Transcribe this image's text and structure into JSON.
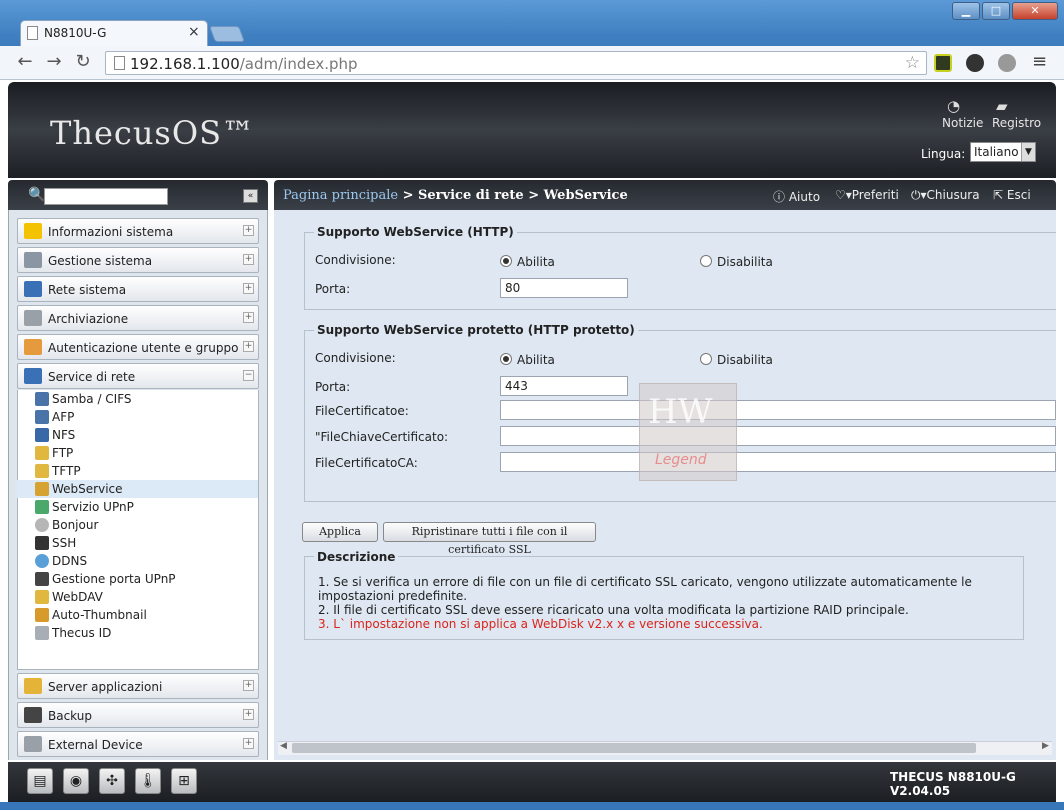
{
  "browser": {
    "tab_title": "N8810U-G",
    "tab_close": "×",
    "url_host": "192.168.1.100",
    "url_path": "/adm/index.php",
    "back": "←",
    "forward": "→",
    "reload": "↻",
    "star": "☆",
    "menu": "≡",
    "win_minimize": "▁",
    "win_maximize": "□",
    "win_close": "✕"
  },
  "header": {
    "logo": "ThecusOS™",
    "notizie": "Notizie",
    "registro": "Registro",
    "lingua_label": "Lingua:",
    "lingua_value": "Italiano"
  },
  "sidebar": {
    "collapse": "«",
    "groups_top": [
      {
        "label": "Informazioni sistema",
        "toggle": "+"
      },
      {
        "label": "Gestione sistema",
        "toggle": "+"
      },
      {
        "label": "Rete sistema",
        "toggle": "+"
      },
      {
        "label": "Archiviazione",
        "toggle": "+"
      },
      {
        "label": "Autenticazione utente e gruppo",
        "toggle": "+"
      },
      {
        "label": "Service di rete",
        "toggle": "−"
      }
    ],
    "subitems": [
      "Samba / CIFS",
      "AFP",
      "NFS",
      "FTP",
      "TFTP",
      "WebService",
      "Servizio UPnP",
      "Bonjour",
      "SSH",
      "DDNS",
      "Gestione porta UPnP",
      "WebDAV",
      "Auto-Thumbnail",
      "Thecus ID"
    ],
    "groups_bottom": [
      {
        "label": "Server applicazioni",
        "toggle": "+"
      },
      {
        "label": "Backup",
        "toggle": "+"
      },
      {
        "label": "External Device",
        "toggle": "+"
      }
    ]
  },
  "breadcrumb": {
    "home": "Pagina principale",
    "rest": " > Service di rete > WebService"
  },
  "actions": {
    "aiuto": "Aiuto",
    "preferiti": "Preferiti",
    "chiusura": "Chiusura",
    "esci": "Esci"
  },
  "http": {
    "legend": "Supporto WebService (HTTP)",
    "condivisione_label": "Condivisione:",
    "abilita": "Abilita",
    "disabilita": "Disabilita",
    "porta_label": "Porta:",
    "porta_value": "80"
  },
  "https": {
    "legend": "Supporto WebService protetto (HTTP protetto)",
    "condivisione_label": "Condivisione:",
    "abilita": "Abilita",
    "disabilita": "Disabilita",
    "porta_label": "Porta:",
    "porta_value": "443",
    "cert_label": "FileCertificatoe:",
    "key_label": "\"FileChiaveCertificato:",
    "ca_label": "FileCertificatoCA:"
  },
  "buttons": {
    "applica": "Applica",
    "ripristina": "Ripristinare tutti i file con il certificato SSL"
  },
  "descrizione": {
    "legend": "Descrizione",
    "line1": "1. Se si verifica un errore di file con un file di certificato SSL caricato, vengono utilizzate automaticamente le impostazioni predefinite.",
    "line2": "2. Il file di certificato SSL deve essere ricaricato una volta modificata la partizione RAID principale.",
    "line3": "3. L` impostazione non si applica a WebDisk v2.x x e versione successiva."
  },
  "watermark": {
    "text": "HW",
    "sub": "Legend"
  },
  "footer": {
    "version": "THECUS N8810U-G V2.04.05"
  },
  "colors": {
    "accent_link": "#9cc8f0",
    "warning_text": "#d9241c",
    "active_item_bg": "#dce9f7"
  }
}
